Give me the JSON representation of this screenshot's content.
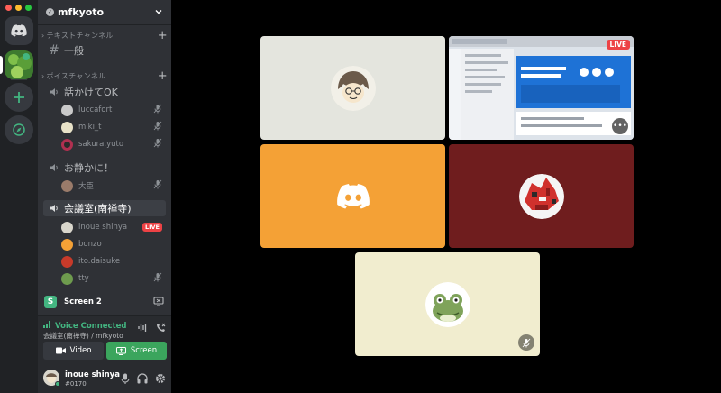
{
  "server": {
    "name": "mfkyoto"
  },
  "sidebar": {
    "text_category": "テキストチャンネル",
    "text_channels": [
      "一般"
    ],
    "voice_category": "ボイスチャンネル",
    "voice_channels": [
      {
        "name": "話かけてOK",
        "users": [
          "luccafort",
          "miki_t",
          "sakura.yuto"
        ]
      },
      {
        "name": "お静かに！",
        "users": [
          "大臣"
        ]
      },
      {
        "name": "会議室(南禅寺)",
        "users": [
          "inoue shinya",
          "bonzo",
          "ito.daisuke",
          "tty"
        ]
      }
    ],
    "live_label": "LIVE",
    "screen_label": "Screen 2",
    "screen_initial": "S"
  },
  "voice_panel": {
    "status": "Voice Connected",
    "location": "会議室(南禅寺) / mfkyoto",
    "video_label": "Video",
    "screen_label": "Screen"
  },
  "user_panel": {
    "name": "inoue shinya",
    "tag": "#0170"
  },
  "stage": {
    "live_label": "LIVE",
    "more_label": "•••",
    "tile_colors": [
      "#e4e5de",
      "#dde3ea",
      "#f4a136",
      "#6f1d1e",
      "#f1edcf"
    ]
  },
  "colors": {
    "accent_green": "#43b581",
    "live_red": "#ed4245",
    "blurple": "#5865f2"
  },
  "icons": [
    "discord-home-icon",
    "add-server-icon",
    "explore-icon",
    "speaker-icon",
    "hash-icon",
    "mute-icon",
    "mic-icon",
    "headphones-icon",
    "settings-icon",
    "video-icon",
    "screen-icon",
    "disconnect-icon"
  ]
}
